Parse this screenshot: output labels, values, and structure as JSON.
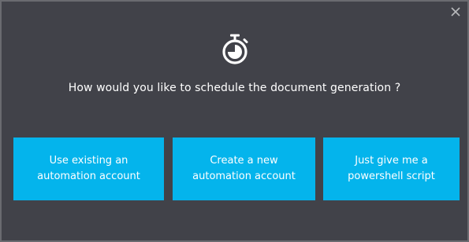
{
  "dialog": {
    "question": "How would you like to schedule the document generation ?",
    "icon": "stopwatch-icon",
    "close_icon": "close-icon",
    "accent_color": "#04b4ec",
    "background_color": "#414249",
    "options": [
      {
        "line1": "Use existing an",
        "line2": "automation account"
      },
      {
        "line1": "Create a new",
        "line2": "automation account"
      },
      {
        "line1": "Just give me a",
        "line2": "powershell script"
      }
    ]
  }
}
